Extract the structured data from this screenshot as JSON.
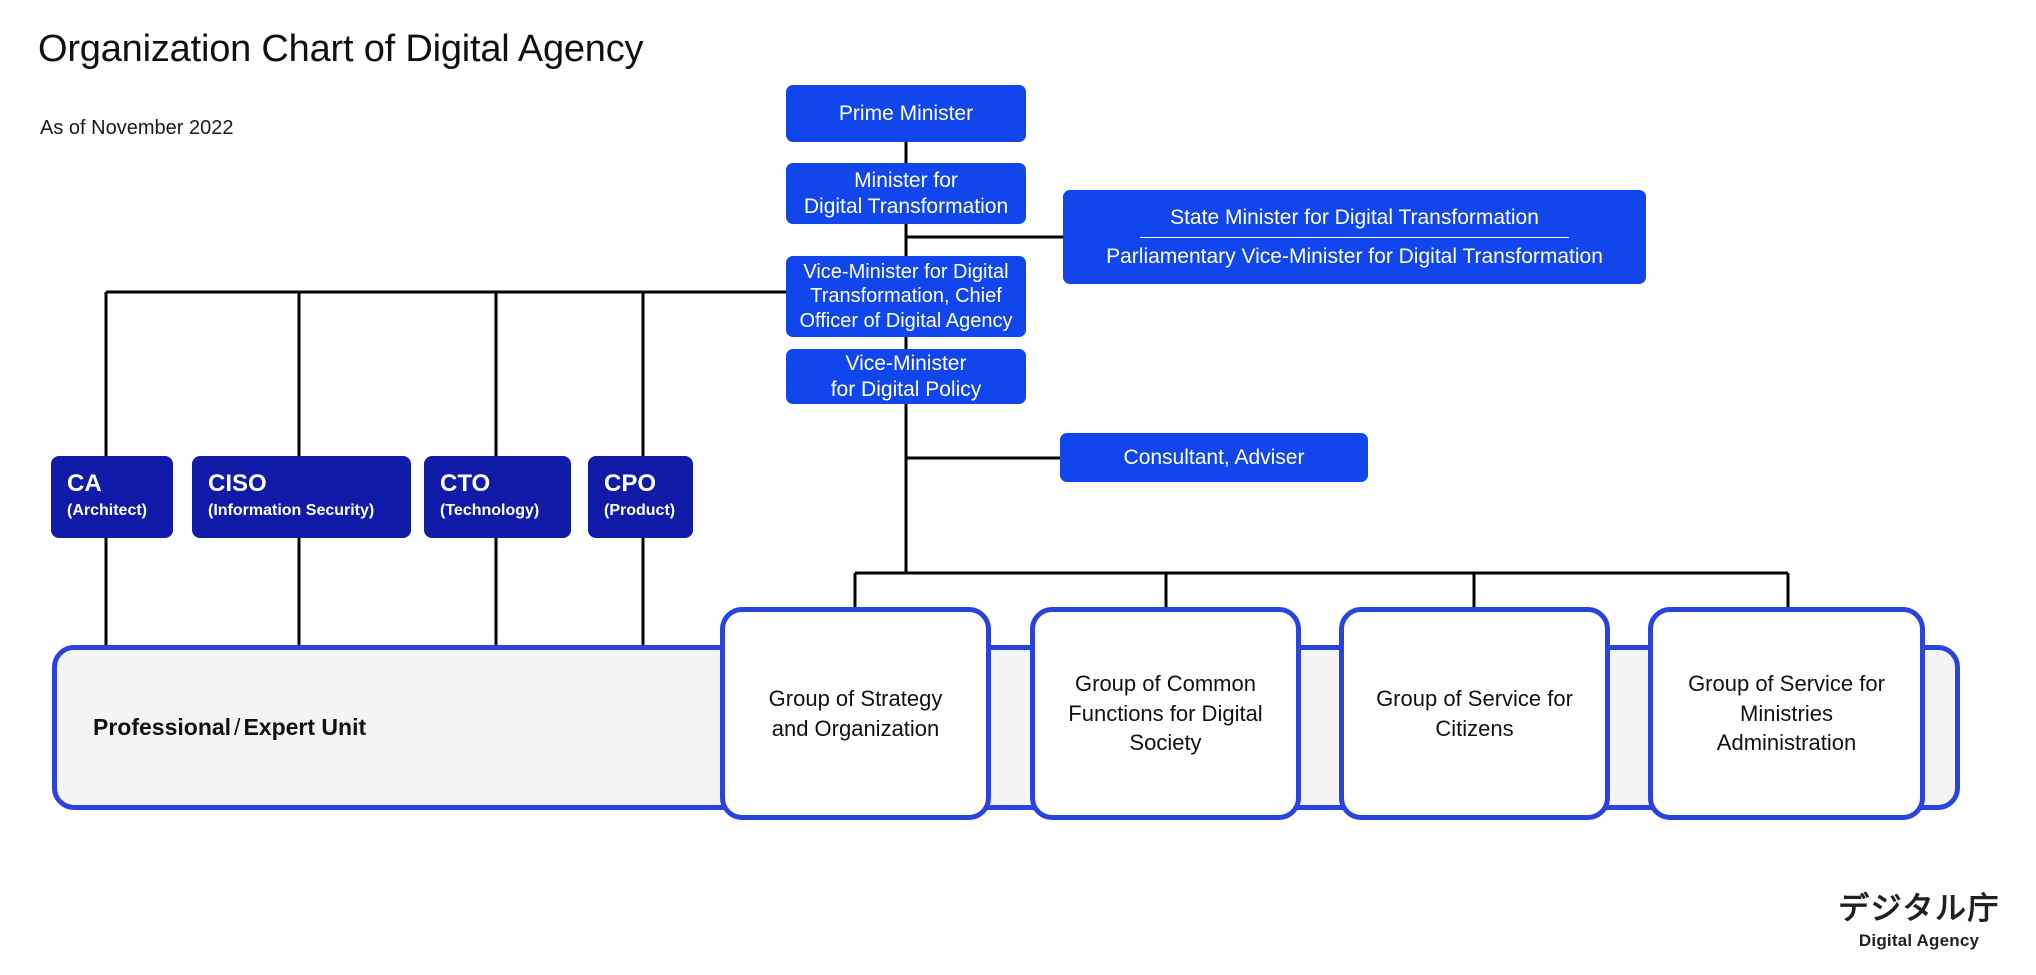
{
  "header": {
    "title": "Organization Chart of Digital Agency",
    "subtitle": "As of November 2022"
  },
  "colors": {
    "bright_blue": "#1046EC",
    "navy_blue": "#101CA7",
    "border_blue": "#2943DE",
    "band_fill": "#F4F4F5",
    "connector": "#000000",
    "text_dark": "#111111",
    "text_light": "#FFFFFF"
  },
  "nodes": {
    "prime_minister": "Prime Minister",
    "minister_line1": "Minister for",
    "minister_line2": "Digital Transformation",
    "state_minister": "State Minister for Digital Transformation",
    "parliamentary_vice_minister": "Parliamentary Vice-Minister for Digital Transformation",
    "vice_minister_dx_line1": "Vice-Minister for Digital",
    "vice_minister_dx_line2": "Transformation, Chief",
    "vice_minister_dx_line3": "Officer of Digital Agency",
    "vice_minister_policy_line1": "Vice-Minister",
    "vice_minister_policy_line2": "for Digital Policy",
    "consultant_adviser": "Consultant, Adviser"
  },
  "officers": [
    {
      "abbr": "CA",
      "full": "(Architect)"
    },
    {
      "abbr": "CISO",
      "full": "(Information Security)"
    },
    {
      "abbr": "CTO",
      "full": "(Technology)"
    },
    {
      "abbr": "CPO",
      "full": "(Product)"
    }
  ],
  "band": {
    "label_bold_1": "Professional",
    "label_sep": "/",
    "label_bold_2": "Expert Unit"
  },
  "groups": [
    {
      "line1": "Group of Strategy",
      "line2": "and Organization",
      "line3": ""
    },
    {
      "line1": "Group of Common",
      "line2": "Functions for Digital",
      "line3": "Society"
    },
    {
      "line1": "Group of Service for",
      "line2": "Citizens",
      "line3": ""
    },
    {
      "line1": "Group of Service for",
      "line2": "Ministries",
      "line3": "Administration"
    }
  ],
  "logo": {
    "japanese": "デジタル庁",
    "english": "Digital Agency"
  },
  "chart_data": {
    "type": "diagram",
    "title": "Organization Chart of Digital Agency",
    "subtitle": "As of November 2022",
    "hierarchy": [
      {
        "id": "prime_minister",
        "label": "Prime Minister",
        "parent": null,
        "style": "bright_blue"
      },
      {
        "id": "minister_dx",
        "label": "Minister for Digital Transformation",
        "parent": "prime_minister",
        "style": "bright_blue"
      },
      {
        "id": "state_minister",
        "label": "State Minister for Digital Transformation / Parliamentary Vice-Minister for Digital Transformation",
        "parent": "minister_dx",
        "style": "bright_blue"
      },
      {
        "id": "vice_minister_dx",
        "label": "Vice-Minister for Digital Transformation, Chief Officer of Digital Agency",
        "parent": "minister_dx",
        "style": "bright_blue"
      },
      {
        "id": "vice_minister_policy",
        "label": "Vice-Minister for Digital Policy",
        "parent": "vice_minister_dx",
        "style": "bright_blue"
      },
      {
        "id": "consultant",
        "label": "Consultant, Adviser",
        "parent": "vice_minister_policy",
        "style": "bright_blue"
      },
      {
        "id": "ca",
        "label": "CA (Architect)",
        "parent": "vice_minister_dx",
        "style": "navy_blue"
      },
      {
        "id": "ciso",
        "label": "CISO (Information Security)",
        "parent": "vice_minister_dx",
        "style": "navy_blue"
      },
      {
        "id": "cto",
        "label": "CTO (Technology)",
        "parent": "vice_minister_dx",
        "style": "navy_blue"
      },
      {
        "id": "cpo",
        "label": "CPO (Product)",
        "parent": "vice_minister_dx",
        "style": "navy_blue"
      },
      {
        "id": "professional_unit",
        "label": "Professional / Expert Unit",
        "parent": "ca,ciso,cto,cpo",
        "style": "gray_band"
      },
      {
        "id": "group_strategy",
        "label": "Group of Strategy and Organization",
        "parent": "vice_minister_policy",
        "style": "white_card"
      },
      {
        "id": "group_common",
        "label": "Group of Common Functions for Digital Society",
        "parent": "vice_minister_policy",
        "style": "white_card"
      },
      {
        "id": "group_citizens",
        "label": "Group of Service for Citizens",
        "parent": "vice_minister_policy",
        "style": "white_card"
      },
      {
        "id": "group_ministries",
        "label": "Group of Service for Ministries Administration",
        "parent": "vice_minister_policy",
        "style": "white_card"
      }
    ]
  }
}
